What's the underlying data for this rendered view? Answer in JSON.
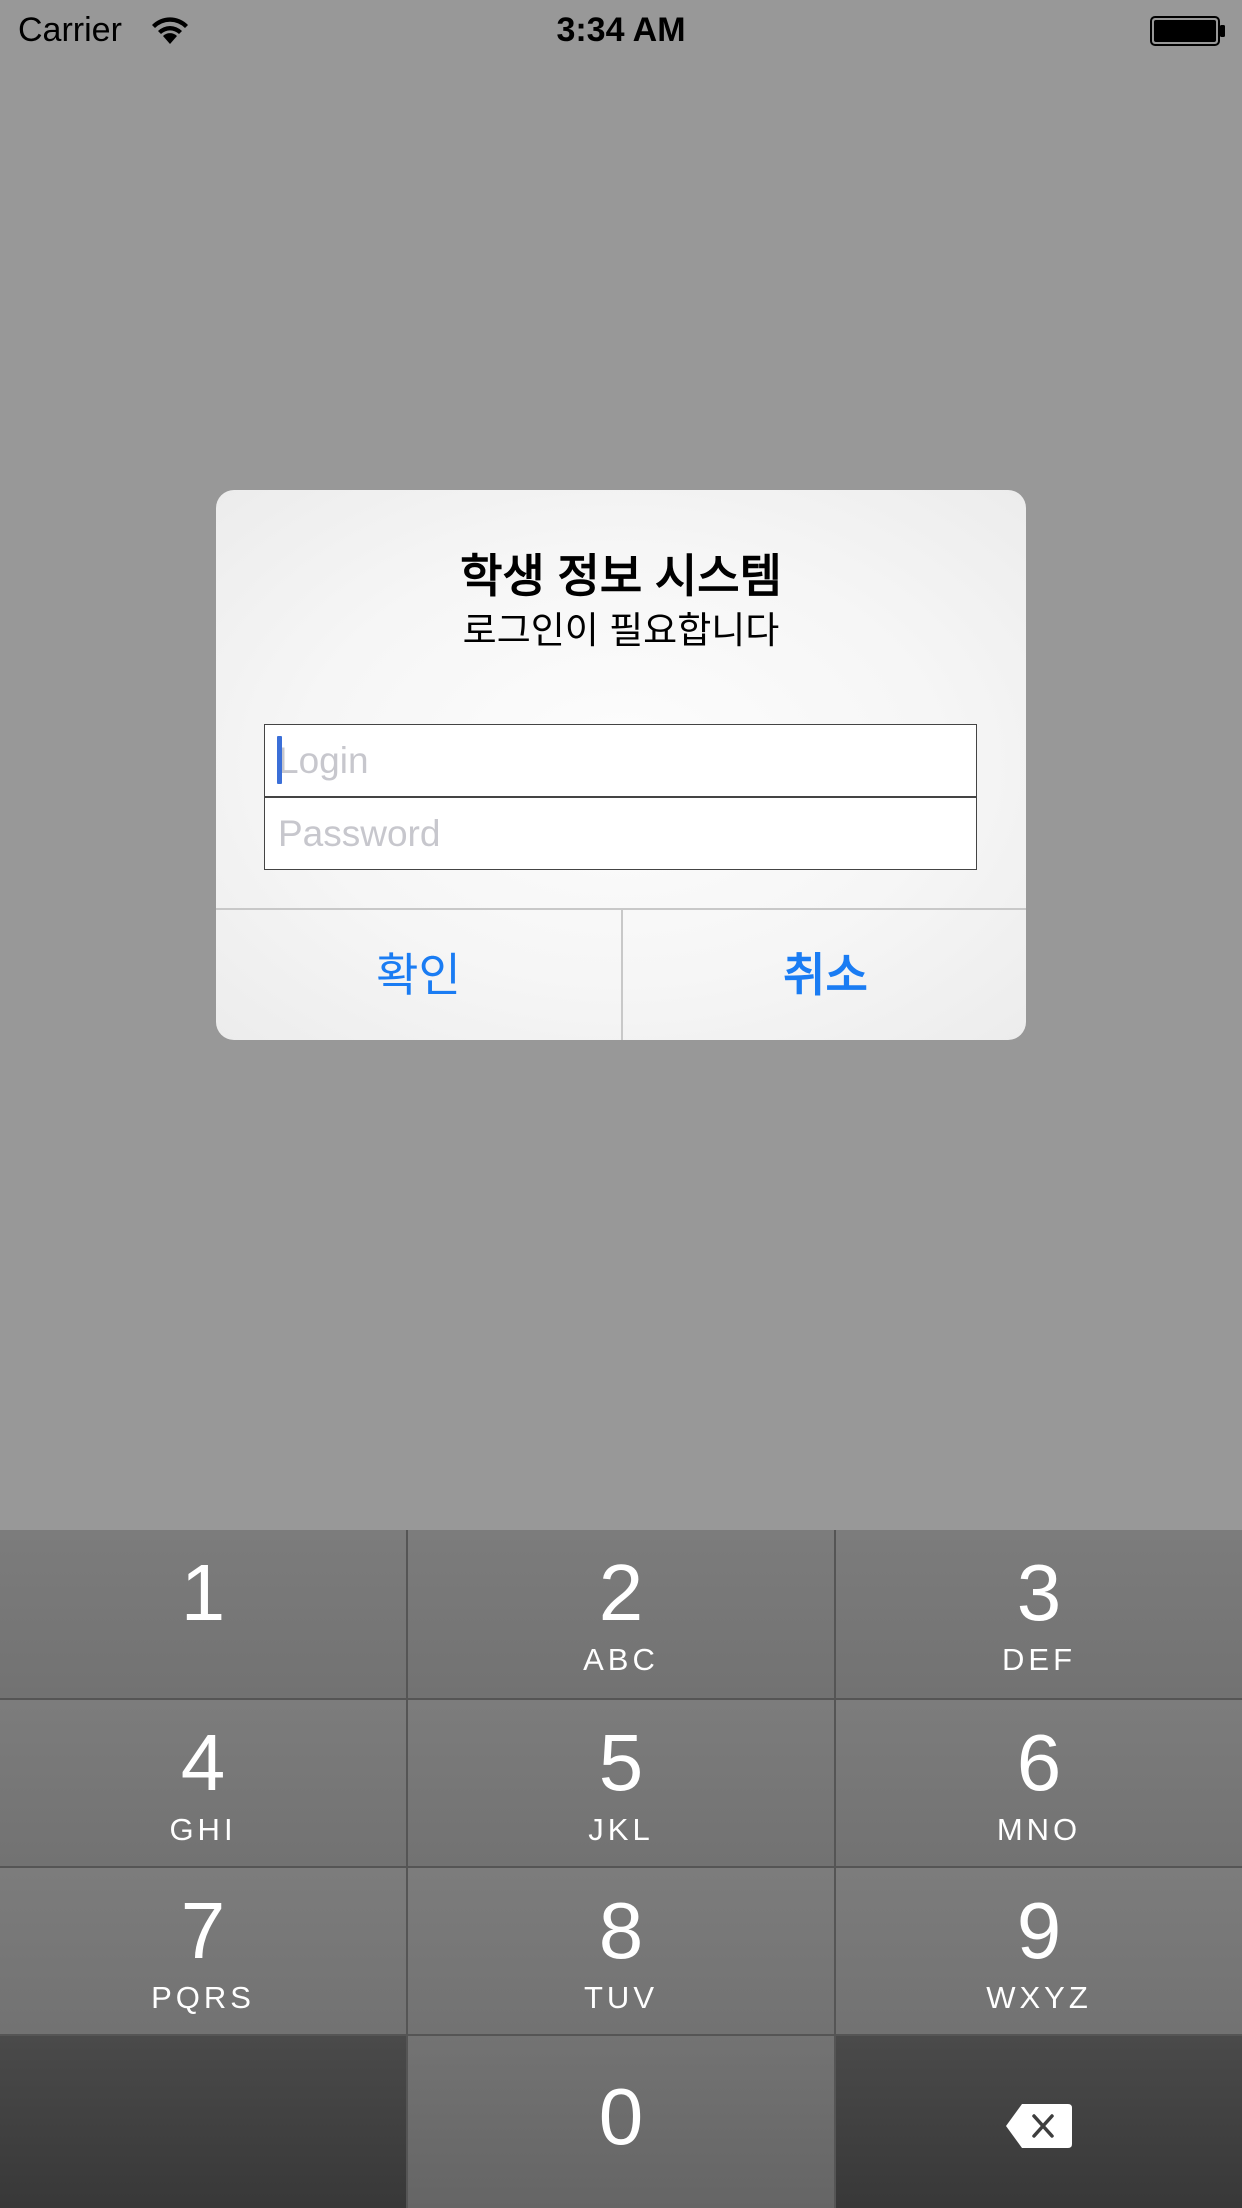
{
  "status_bar": {
    "carrier": "Carrier",
    "time": "3:34 AM",
    "icons": [
      "wifi-icon",
      "battery-icon"
    ]
  },
  "alert": {
    "title": "학생 정보 시스템",
    "message": "로그인이 필요합니다",
    "login_placeholder": "Login",
    "login_value": "",
    "password_placeholder": "Password",
    "password_value": "",
    "ok_label": "확인",
    "cancel_label": "취소",
    "button_color": "#1a7cf3"
  },
  "keypad": {
    "keys": [
      {
        "digit": "1",
        "letters": ""
      },
      {
        "digit": "2",
        "letters": "ABC"
      },
      {
        "digit": "3",
        "letters": "DEF"
      },
      {
        "digit": "4",
        "letters": "GHI"
      },
      {
        "digit": "5",
        "letters": "JKL"
      },
      {
        "digit": "6",
        "letters": "MNO"
      },
      {
        "digit": "7",
        "letters": "PQRS"
      },
      {
        "digit": "8",
        "letters": "TUV"
      },
      {
        "digit": "9",
        "letters": "WXYZ"
      },
      {
        "digit": "0",
        "letters": ""
      }
    ],
    "backspace_icon": "backspace-icon"
  }
}
